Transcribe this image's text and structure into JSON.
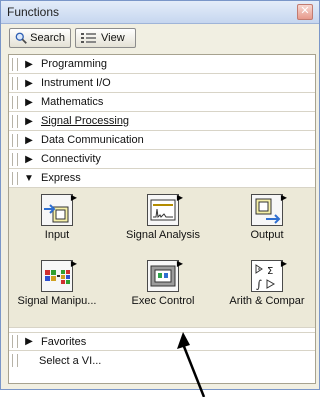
{
  "window": {
    "title": "Functions"
  },
  "toolbar": {
    "search_label": "Search",
    "view_label": "View"
  },
  "categories": [
    {
      "label": "Programming"
    },
    {
      "label": "Instrument I/O"
    },
    {
      "label": "Mathematics"
    },
    {
      "label": "Signal Processing"
    },
    {
      "label": "Data Communication"
    },
    {
      "label": "Connectivity"
    },
    {
      "label": "Express"
    }
  ],
  "express_items": [
    {
      "label": "Input",
      "icon": "input-icon"
    },
    {
      "label": "Signal Analysis",
      "icon": "signal-analysis-icon"
    },
    {
      "label": "Output",
      "icon": "output-icon"
    },
    {
      "label": "Signal Manipu...",
      "icon": "signal-manipulation-icon"
    },
    {
      "label": "Exec Control",
      "icon": "exec-control-icon"
    },
    {
      "label": "Arith & Compar",
      "icon": "arith-compare-icon"
    }
  ],
  "bottom_items": [
    {
      "label": "Favorites"
    },
    {
      "label": "Select a VI..."
    }
  ],
  "colors": {
    "title_bar": "#c6d6ef",
    "panel_bg": "#ece9d8",
    "accent_blue": "#2f5fb3"
  }
}
